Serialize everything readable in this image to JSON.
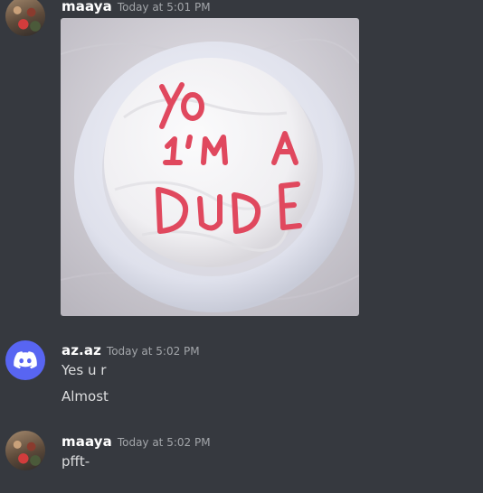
{
  "messages": [
    {
      "username": "maaya",
      "timestamp": "Today at 5:01 PM",
      "avatar_icon": "user-photo-avatar",
      "attachment": {
        "type": "image",
        "cake_text_line1": "YO",
        "cake_text_line2": "I'M A",
        "cake_text_line3": "DUDE"
      }
    },
    {
      "username": "az.az",
      "timestamp": "Today at 5:02 PM",
      "avatar_icon": "discord-logo-icon",
      "lines": [
        "Yes u r",
        "Almost"
      ]
    },
    {
      "username": "maaya",
      "timestamp": "Today at 5:02 PM",
      "avatar_icon": "user-photo-avatar",
      "lines": [
        "pfft-"
      ]
    }
  ],
  "colors": {
    "background": "#36393f",
    "username": "#ffffff",
    "timestamp": "#a3a6aa",
    "message_text": "#dcddde",
    "discord_blurple": "#5865f2",
    "icing_text": "#e0485e"
  }
}
